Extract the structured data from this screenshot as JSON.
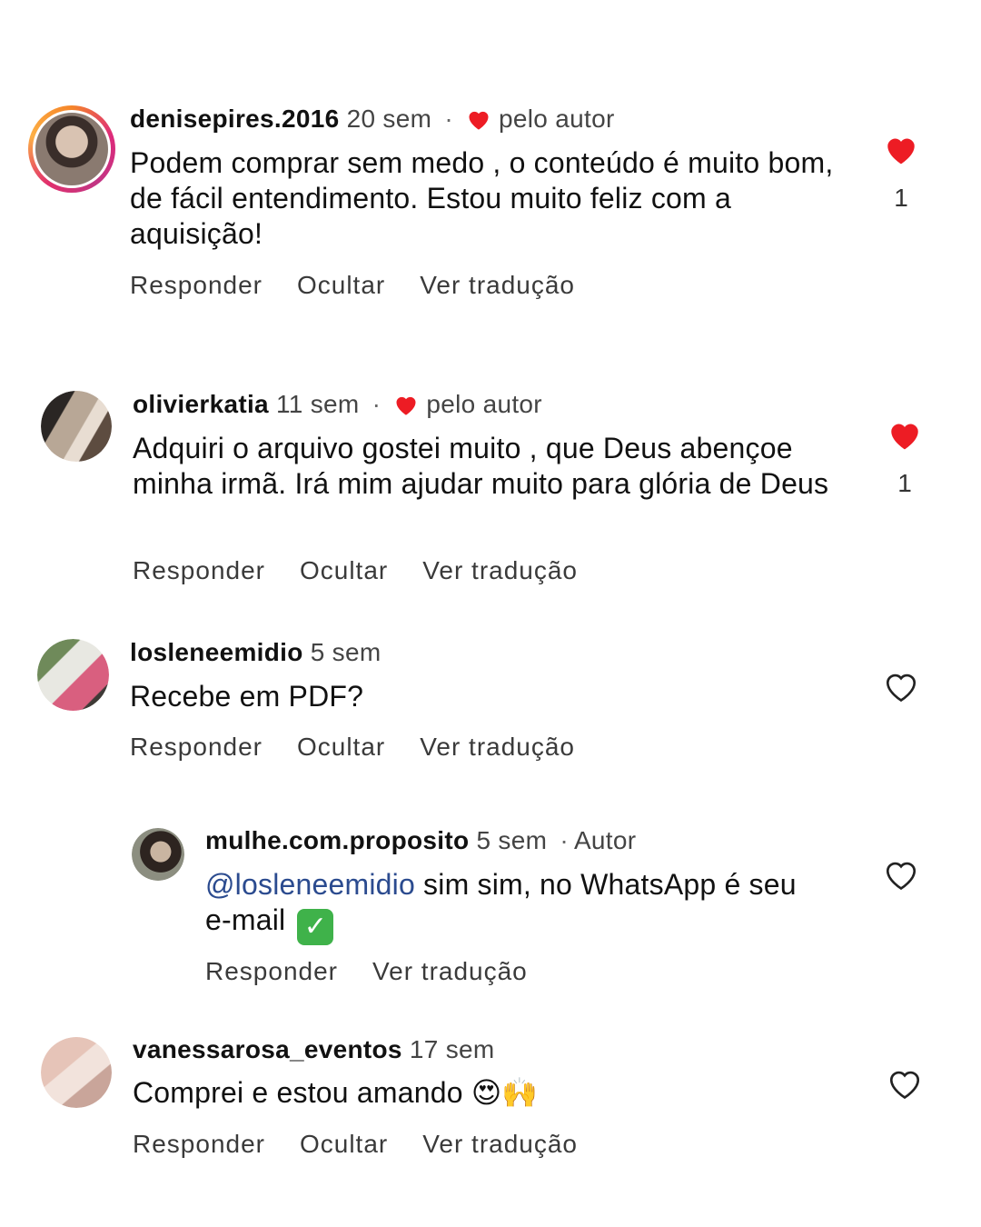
{
  "colors": {
    "heart": "#ed1c24",
    "mention": "#2b4b8f"
  },
  "comments": [
    {
      "username": "denisepires.2016",
      "time": "20 sem",
      "separator": "·",
      "author_like": "pelo autor",
      "text": "Podem comprar sem medo , o conteúdo é muito bom, de fácil entendimento. Estou muito feliz com a aquisição!",
      "actions": [
        "Responder",
        "Ocultar",
        "Ver tradução"
      ],
      "likes": "1",
      "liked": true
    },
    {
      "username": "olivierkatia",
      "time": "11 sem",
      "separator": "·",
      "author_like": "pelo autor",
      "text": "Adquiri o arquivo gostei muito , que Deus abençoe minha irmã.  Irá mim ajudar muito para glória de Deus",
      "actions": [
        "Responder",
        "Ocultar",
        "Ver tradução"
      ],
      "likes": "1",
      "liked": true
    },
    {
      "username": "losleneemidio",
      "time": "5 sem",
      "text": "Recebe em PDF?",
      "actions": [
        "Responder",
        "Ocultar",
        "Ver tradução"
      ],
      "liked": false
    },
    {
      "username": "mulhe.com.proposito",
      "time": "5 sem",
      "separator": "·",
      "badge": "Autor",
      "mention": "@losleneemidio",
      "text": " sim sim, no WhatsApp é seu e-mail",
      "check_icon": "✓",
      "actions": [
        "Responder",
        "Ver tradução"
      ],
      "liked": false
    },
    {
      "username": "vanessarosa_eventos",
      "time": "17 sem",
      "text": "Comprei e estou amando",
      "emojis": "😍🙌",
      "actions": [
        "Responder",
        "Ocultar",
        "Ver tradução"
      ],
      "liked": false
    }
  ]
}
